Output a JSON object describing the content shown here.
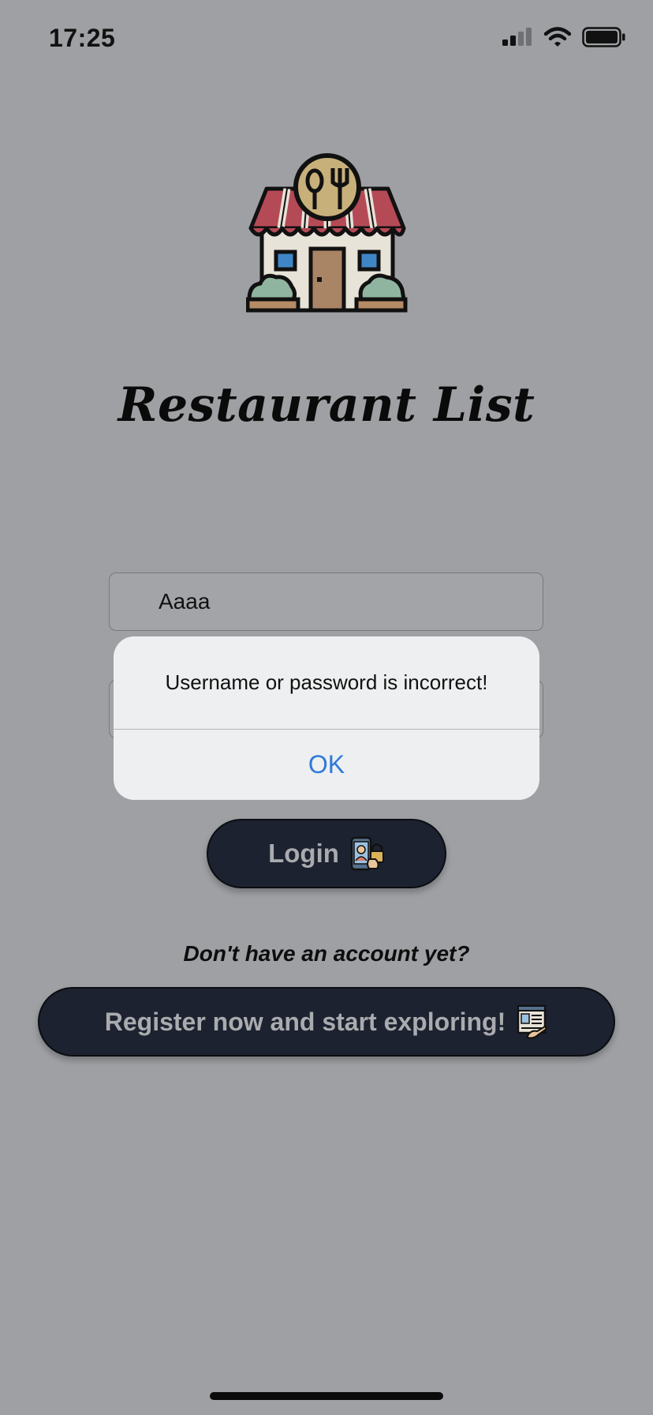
{
  "status_bar": {
    "time": "17:25",
    "icons": [
      "signal-icon",
      "wifi-icon",
      "battery-icon"
    ]
  },
  "app": {
    "logo_icon": "restaurant-storefront-icon",
    "title": "Restaurant List"
  },
  "form": {
    "username_value": "Aaaa",
    "password_value": "",
    "login_label": "Login",
    "login_icon": "phone-lock-icon"
  },
  "register": {
    "prompt": "Don't have an account yet?",
    "button_label": "Register now and start exploring!",
    "button_icon": "registration-form-icon"
  },
  "alert": {
    "message": "Username or password is incorrect!",
    "ok_label": "OK"
  },
  "colors": {
    "background": "#9ea0a3",
    "button_bg": "#1d2230",
    "alert_bg": "#eeeff0",
    "alert_action": "#2d79dd"
  }
}
